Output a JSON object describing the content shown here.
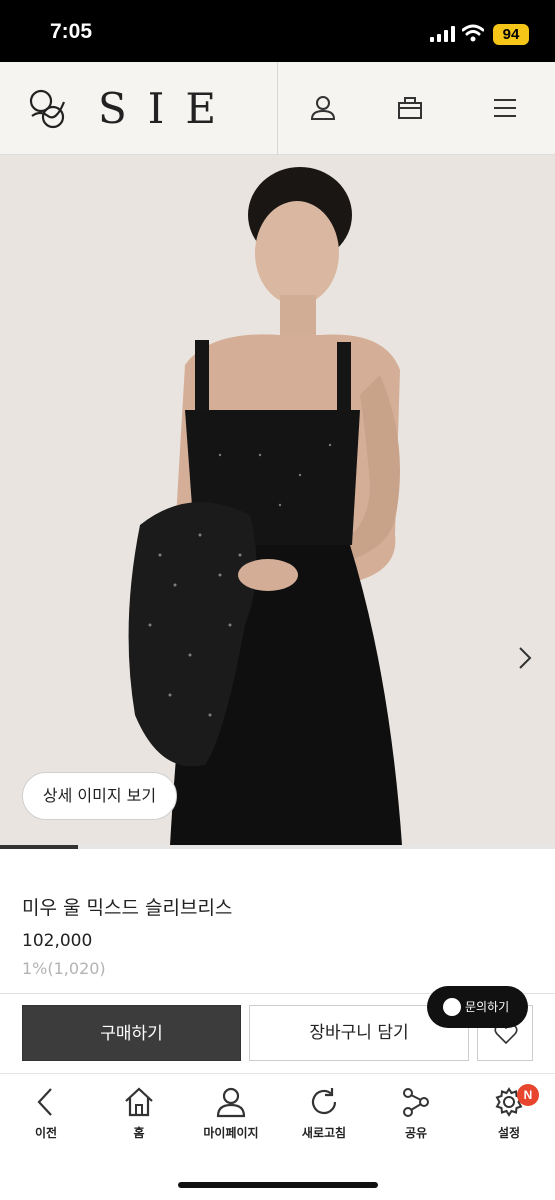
{
  "status_bar": {
    "time": "7:05",
    "battery": "94"
  },
  "header": {
    "brand": "SIE"
  },
  "hero": {
    "detail_button": "상세 이미지 보기",
    "slide_progress": 0.14
  },
  "product": {
    "name": "미우 울 믹스드 슬리브리스",
    "price": "102,000",
    "point": "1%(1,020)"
  },
  "actions": {
    "chat": "문의하기",
    "buy": "구매하기",
    "cart": "장바구니 담기"
  },
  "nav": [
    {
      "label": "이전",
      "icon": "back-arrow-icon"
    },
    {
      "label": "홈",
      "icon": "home-icon"
    },
    {
      "label": "마이페이지",
      "icon": "person-icon"
    },
    {
      "label": "새로고침",
      "icon": "refresh-icon"
    },
    {
      "label": "공유",
      "icon": "share-icon"
    },
    {
      "label": "설정",
      "icon": "gear-icon",
      "badge": "N"
    }
  ],
  "colors": {
    "header_bg": "#f5f4f0",
    "hero_bg": "#e9e4df",
    "buy_bg": "#3c3c3c",
    "badge": "#e8452e",
    "battery": "#f5c518"
  }
}
